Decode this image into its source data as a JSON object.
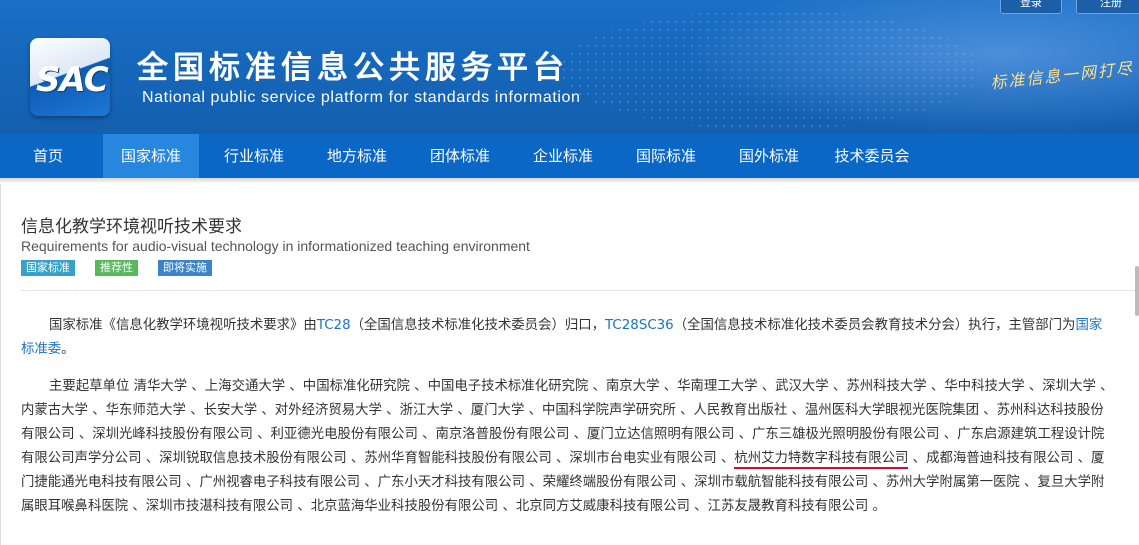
{
  "header": {
    "logo_text": "SAC",
    "title": "全国标准信息公共服务平台",
    "subtitle": "National public service platform  for standards information",
    "slogan": "标准信息一网打尽",
    "login_label": "登录",
    "register_label": "注册"
  },
  "nav": {
    "items": [
      "首页",
      "国家标准",
      "行业标准",
      "地方标准",
      "团体标准",
      "企业标准",
      "国际标准",
      "国外标准",
      "技术委员会"
    ],
    "active": "国家标准"
  },
  "standard": {
    "title": "信息化教学环境视听技术要求",
    "title_en": "Requirements for audio-visual technology in informationized teaching environment",
    "tags": [
      "国家标准",
      "推荐性",
      "即将实施"
    ]
  },
  "para1": {
    "t1": "国家标准《信息化教学环境视听技术要求》由",
    "tc": "TC28",
    "t2": "（全国信息技术标准化技术委员会）归口，",
    "sc": "TC28SC36",
    "t3": "（全国信息技术标准化技术委员会教育技术分会）执行，主管部门为",
    "dept": "国家标准委",
    "t4": "。"
  },
  "para2": {
    "pre": "主要起草单位 清华大学 、上海交通大学 、中国标准化研究院 、中国电子技术标准化研究院 、南京大学 、华南理工大学 、武汉大学 、苏州科技大学 、华中科技大学 、深圳大学 、内蒙古大学 、华东师范大学 、长安大学 、对外经济贸易大学 、浙江大学 、厦门大学 、中国科学院声学研究所 、人民教育出版社 、温州医科大学眼视光医院集团 、苏州科达科技股份有限公司 、深圳光峰科技股份有限公司 、利亚德光电股份有限公司 、南京洛普股份有限公司 、厦门立达信照明有限公司 、广东三雄极光照明股份有限公司 、广东启源建筑工程设计院有限公司声学分公司 、深圳锐取信息技术股份有限公司 、苏州华育智能科技股份有限公司 、深圳市台电实业有限公司 、",
    "highlight": "杭州艾力特数字科技有限公司",
    "post": " 、成都海普迪科技有限公司 、厦门捷能通光电科技有限公司 、广州视睿电子科技有限公司 、广东小天才科技有限公司 、荣耀终端股份有限公司 、深圳市载航智能科技有限公司 、苏州大学附属第一医院 、复旦大学附属眼耳喉鼻科医院 、深圳市技湛科技有限公司 、北京蓝海华业科技股份有限公司 、北京同方艾威康科技有限公司 、江苏友晟教育科技有限公司 。"
  },
  "colors": {
    "banner": "#1565b8",
    "nav": "#0b67c5",
    "nav_active": "#2787df",
    "link": "#1a73c6",
    "highlight_underline": "#c8102e"
  }
}
